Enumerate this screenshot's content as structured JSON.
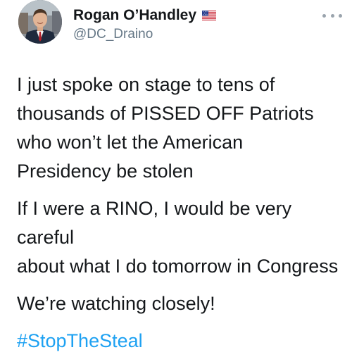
{
  "author": {
    "display_name": "Rogan O’Handley",
    "handle": "@DC_Draino",
    "flag_icon": "us-flag-icon",
    "avatar": "avatar"
  },
  "menu": {
    "icon": "more-icon"
  },
  "tweet": {
    "paragraphs": [
      "I just spoke on stage to tens of\nthousands of PISSED OFF Patriots\nwho won’t let the American\nPresidency be stolen",
      "If I were a RINO, I would be very careful\nabout what I do tomorrow in Congress",
      "We’re watching closely!"
    ],
    "hashtag": "#StopTheSteal"
  },
  "colors": {
    "text": "#14171a",
    "handle": "#657786",
    "link": "#1da1f2"
  }
}
